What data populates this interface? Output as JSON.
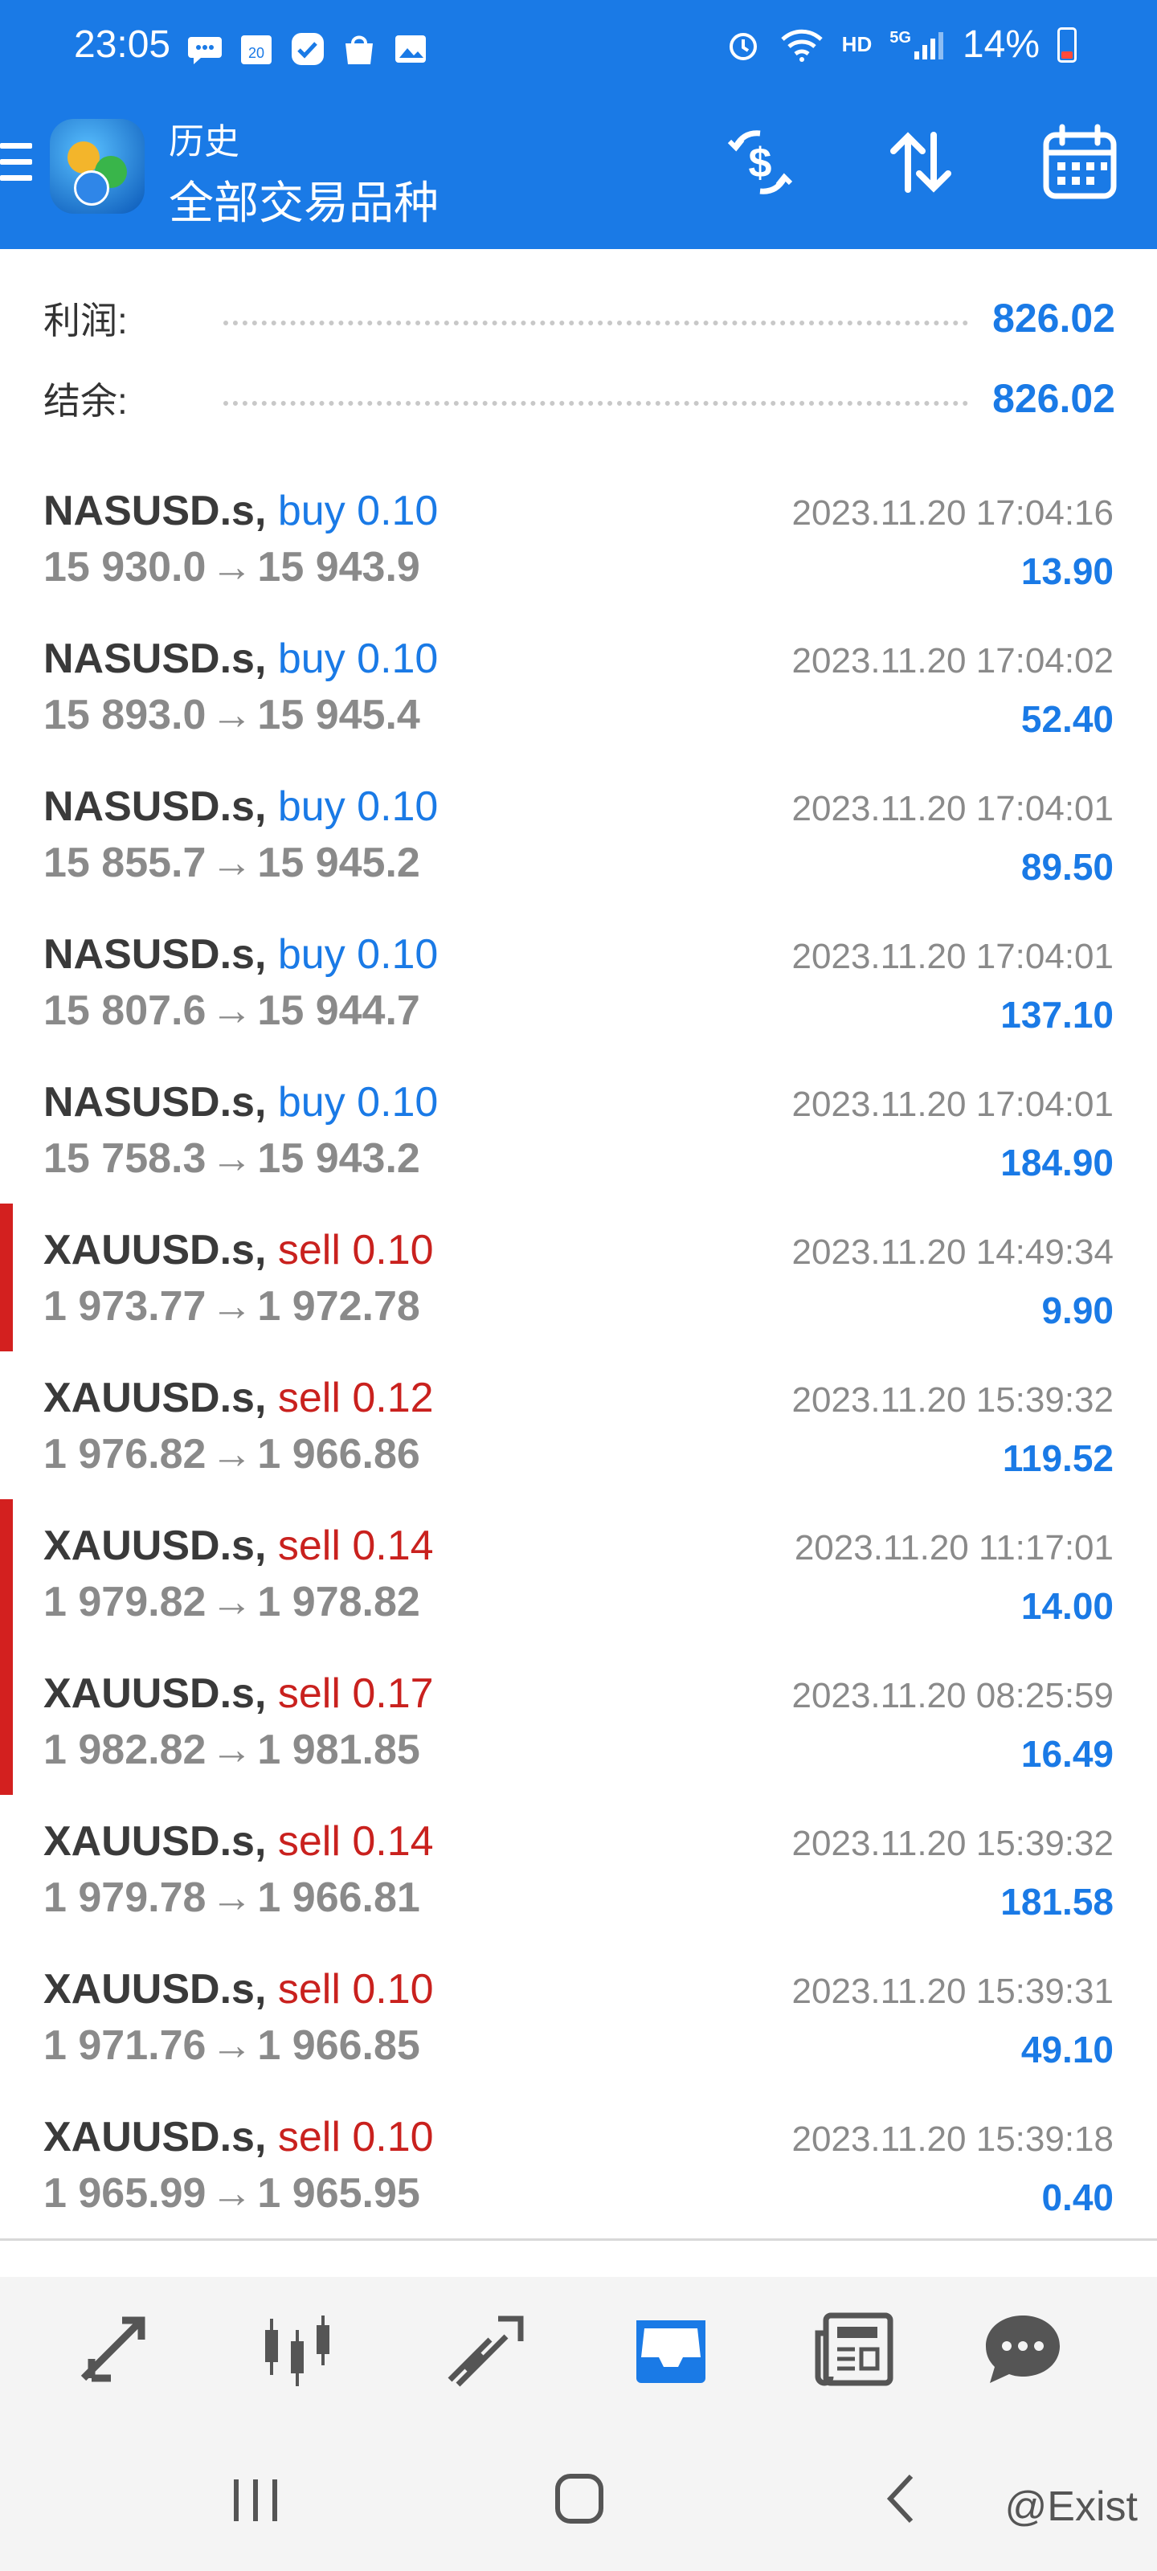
{
  "status_bar": {
    "time": "23:05",
    "notif_icons": [
      "chat-bubble-icon",
      "calendar-20-icon",
      "check-badge-icon",
      "shopping-bag-icon",
      "image-icon"
    ],
    "calendar_day": "20",
    "right_icons": [
      "alarm-icon",
      "wifi-icon",
      "hd-icon",
      "5g-signal-icon"
    ],
    "hd": "HD",
    "network": "5G",
    "battery": "14%"
  },
  "header": {
    "subtitle": "历史",
    "title": "全部交易品种",
    "actions": [
      "currency-exchange-icon",
      "sort-icon",
      "calendar-icon"
    ]
  },
  "summary": {
    "profit_label": "利润:",
    "profit_value": "826.02",
    "balance_label": "结余:",
    "balance_value": "826.02"
  },
  "deals": [
    {
      "symbol": "NASUSD.s,",
      "type": "buy 0.10",
      "side": "buy",
      "open": "15 930.0",
      "close": "15 943.9",
      "time": "2023.11.20 17:04:16",
      "profit": "13.90",
      "marker": false
    },
    {
      "symbol": "NASUSD.s,",
      "type": "buy 0.10",
      "side": "buy",
      "open": "15 893.0",
      "close": "15 945.4",
      "time": "2023.11.20 17:04:02",
      "profit": "52.40",
      "marker": false
    },
    {
      "symbol": "NASUSD.s,",
      "type": "buy 0.10",
      "side": "buy",
      "open": "15 855.7",
      "close": "15 945.2",
      "time": "2023.11.20 17:04:01",
      "profit": "89.50",
      "marker": false
    },
    {
      "symbol": "NASUSD.s,",
      "type": "buy 0.10",
      "side": "buy",
      "open": "15 807.6",
      "close": "15 944.7",
      "time": "2023.11.20 17:04:01",
      "profit": "137.10",
      "marker": false
    },
    {
      "symbol": "NASUSD.s,",
      "type": "buy 0.10",
      "side": "buy",
      "open": "15 758.3",
      "close": "15 943.2",
      "time": "2023.11.20 17:04:01",
      "profit": "184.90",
      "marker": false
    },
    {
      "symbol": "XAUUSD.s,",
      "type": "sell 0.10",
      "side": "sell",
      "open": "1 973.77",
      "close": "1 972.78",
      "time": "2023.11.20 14:49:34",
      "profit": "9.90",
      "marker": true
    },
    {
      "symbol": "XAUUSD.s,",
      "type": "sell 0.12",
      "side": "sell",
      "open": "1 976.82",
      "close": "1 966.86",
      "time": "2023.11.20 15:39:32",
      "profit": "119.52",
      "marker": false
    },
    {
      "symbol": "XAUUSD.s,",
      "type": "sell 0.14",
      "side": "sell",
      "open": "1 979.82",
      "close": "1 978.82",
      "time": "2023.11.20 11:17:01",
      "profit": "14.00",
      "marker": true
    },
    {
      "symbol": "XAUUSD.s,",
      "type": "sell 0.17",
      "side": "sell",
      "open": "1 982.82",
      "close": "1 981.85",
      "time": "2023.11.20 08:25:59",
      "profit": "16.49",
      "marker": true
    },
    {
      "symbol": "XAUUSD.s,",
      "type": "sell 0.14",
      "side": "sell",
      "open": "1 979.78",
      "close": "1 966.81",
      "time": "2023.11.20 15:39:32",
      "profit": "181.58",
      "marker": false
    },
    {
      "symbol": "XAUUSD.s,",
      "type": "sell 0.10",
      "side": "sell",
      "open": "1 971.76",
      "close": "1 966.85",
      "time": "2023.11.20 15:39:31",
      "profit": "49.10",
      "marker": false
    },
    {
      "symbol": "XAUUSD.s,",
      "type": "sell 0.10",
      "side": "sell",
      "open": "1 965.99",
      "close": "1 965.95",
      "time": "2023.11.20 15:39:18",
      "profit": "0.40",
      "marker": false
    }
  ],
  "arrow": "→",
  "bottom_nav": {
    "items": [
      "trade-arrows-icon",
      "candlestick-chart-icon",
      "trend-lines-icon",
      "history-inbox-icon",
      "news-icon",
      "chat-icon"
    ],
    "active": "history-inbox-icon",
    "active_color": "#1a7ae6"
  },
  "system_nav": [
    "recent-apps-icon",
    "home-icon",
    "back-icon"
  ],
  "watermark": "@Exist"
}
